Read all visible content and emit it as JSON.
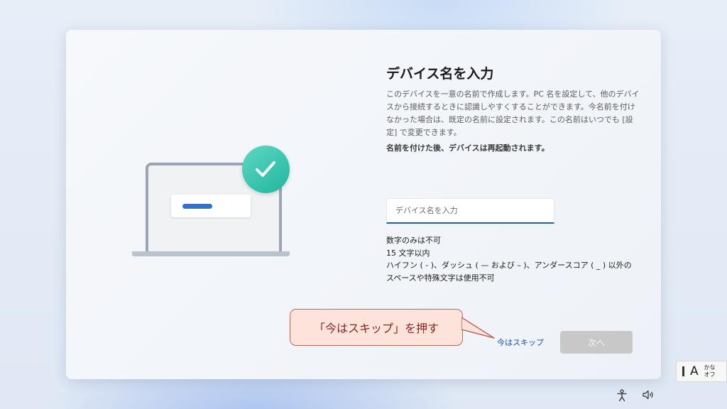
{
  "setup": {
    "title": "デバイス名を入力",
    "description": "このデバイスを一意の名前で作成します。PC 名を設定して、他のデバイスから接続するときに認識しやすくすることができます。今名前を付けなかった場合は、既定の名前に設定されます。この名前はいつでも [設定] で変更できます。",
    "restart_note": "名前を付けた後、デバイスは再起動されます。",
    "name_input": {
      "value": "",
      "placeholder": "デバイス名を入力"
    },
    "rules": [
      "数字のみは不可",
      "15 文字以内",
      "ハイフン ( - )、ダッシュ ( — および – )、アンダースコア ( _ ) 以外の",
      "スペースや特殊文字は使用不可"
    ],
    "skip_label": "今はスキップ",
    "next_label": "次へ"
  },
  "callout": {
    "text": "「今はスキップ」を押す"
  },
  "ime": {
    "mode_char": "A",
    "kana_line1": "かな",
    "kana_line2": "オフ"
  },
  "icons": {
    "illustration": "laptop-with-checkmark",
    "accessibility": "accessibility-icon",
    "volume": "volume-icon"
  },
  "colors": {
    "accent_blue": "#1f5fad",
    "check_green": "#1fb79e",
    "callout_fill": "#fde3d9",
    "callout_text": "#8a2323",
    "next_disabled": "#c8c8c8"
  }
}
